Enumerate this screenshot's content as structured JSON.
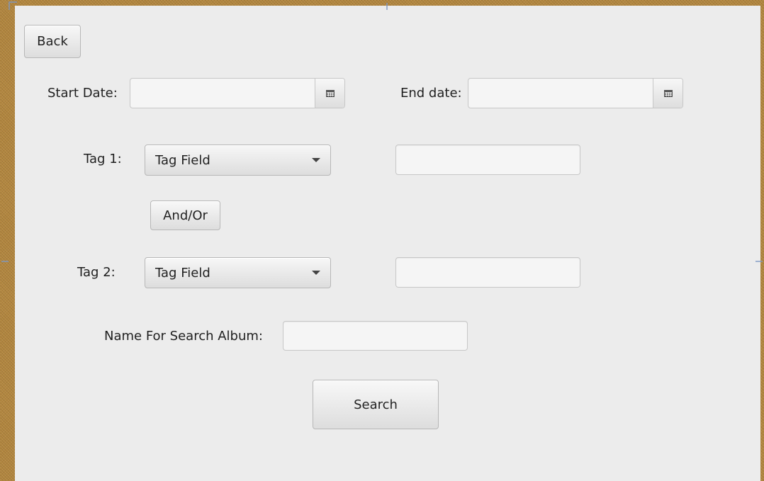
{
  "header": {
    "back_label": "Back"
  },
  "dates": {
    "start_label": "Start Date:",
    "start_value": "",
    "end_label": "End date:",
    "end_value": "",
    "picker_icon": "calendar-icon"
  },
  "tag1": {
    "label": "Tag 1:",
    "combo_value": "Tag Field",
    "text_value": ""
  },
  "logic": {
    "and_or_label": "And/Or"
  },
  "tag2": {
    "label": "Tag 2:",
    "combo_value": "Tag Field",
    "text_value": ""
  },
  "album": {
    "label": "Name For Search Album:",
    "value": ""
  },
  "actions": {
    "search_label": "Search"
  },
  "colors": {
    "background": "#ececec",
    "frame": "#b3873f"
  }
}
